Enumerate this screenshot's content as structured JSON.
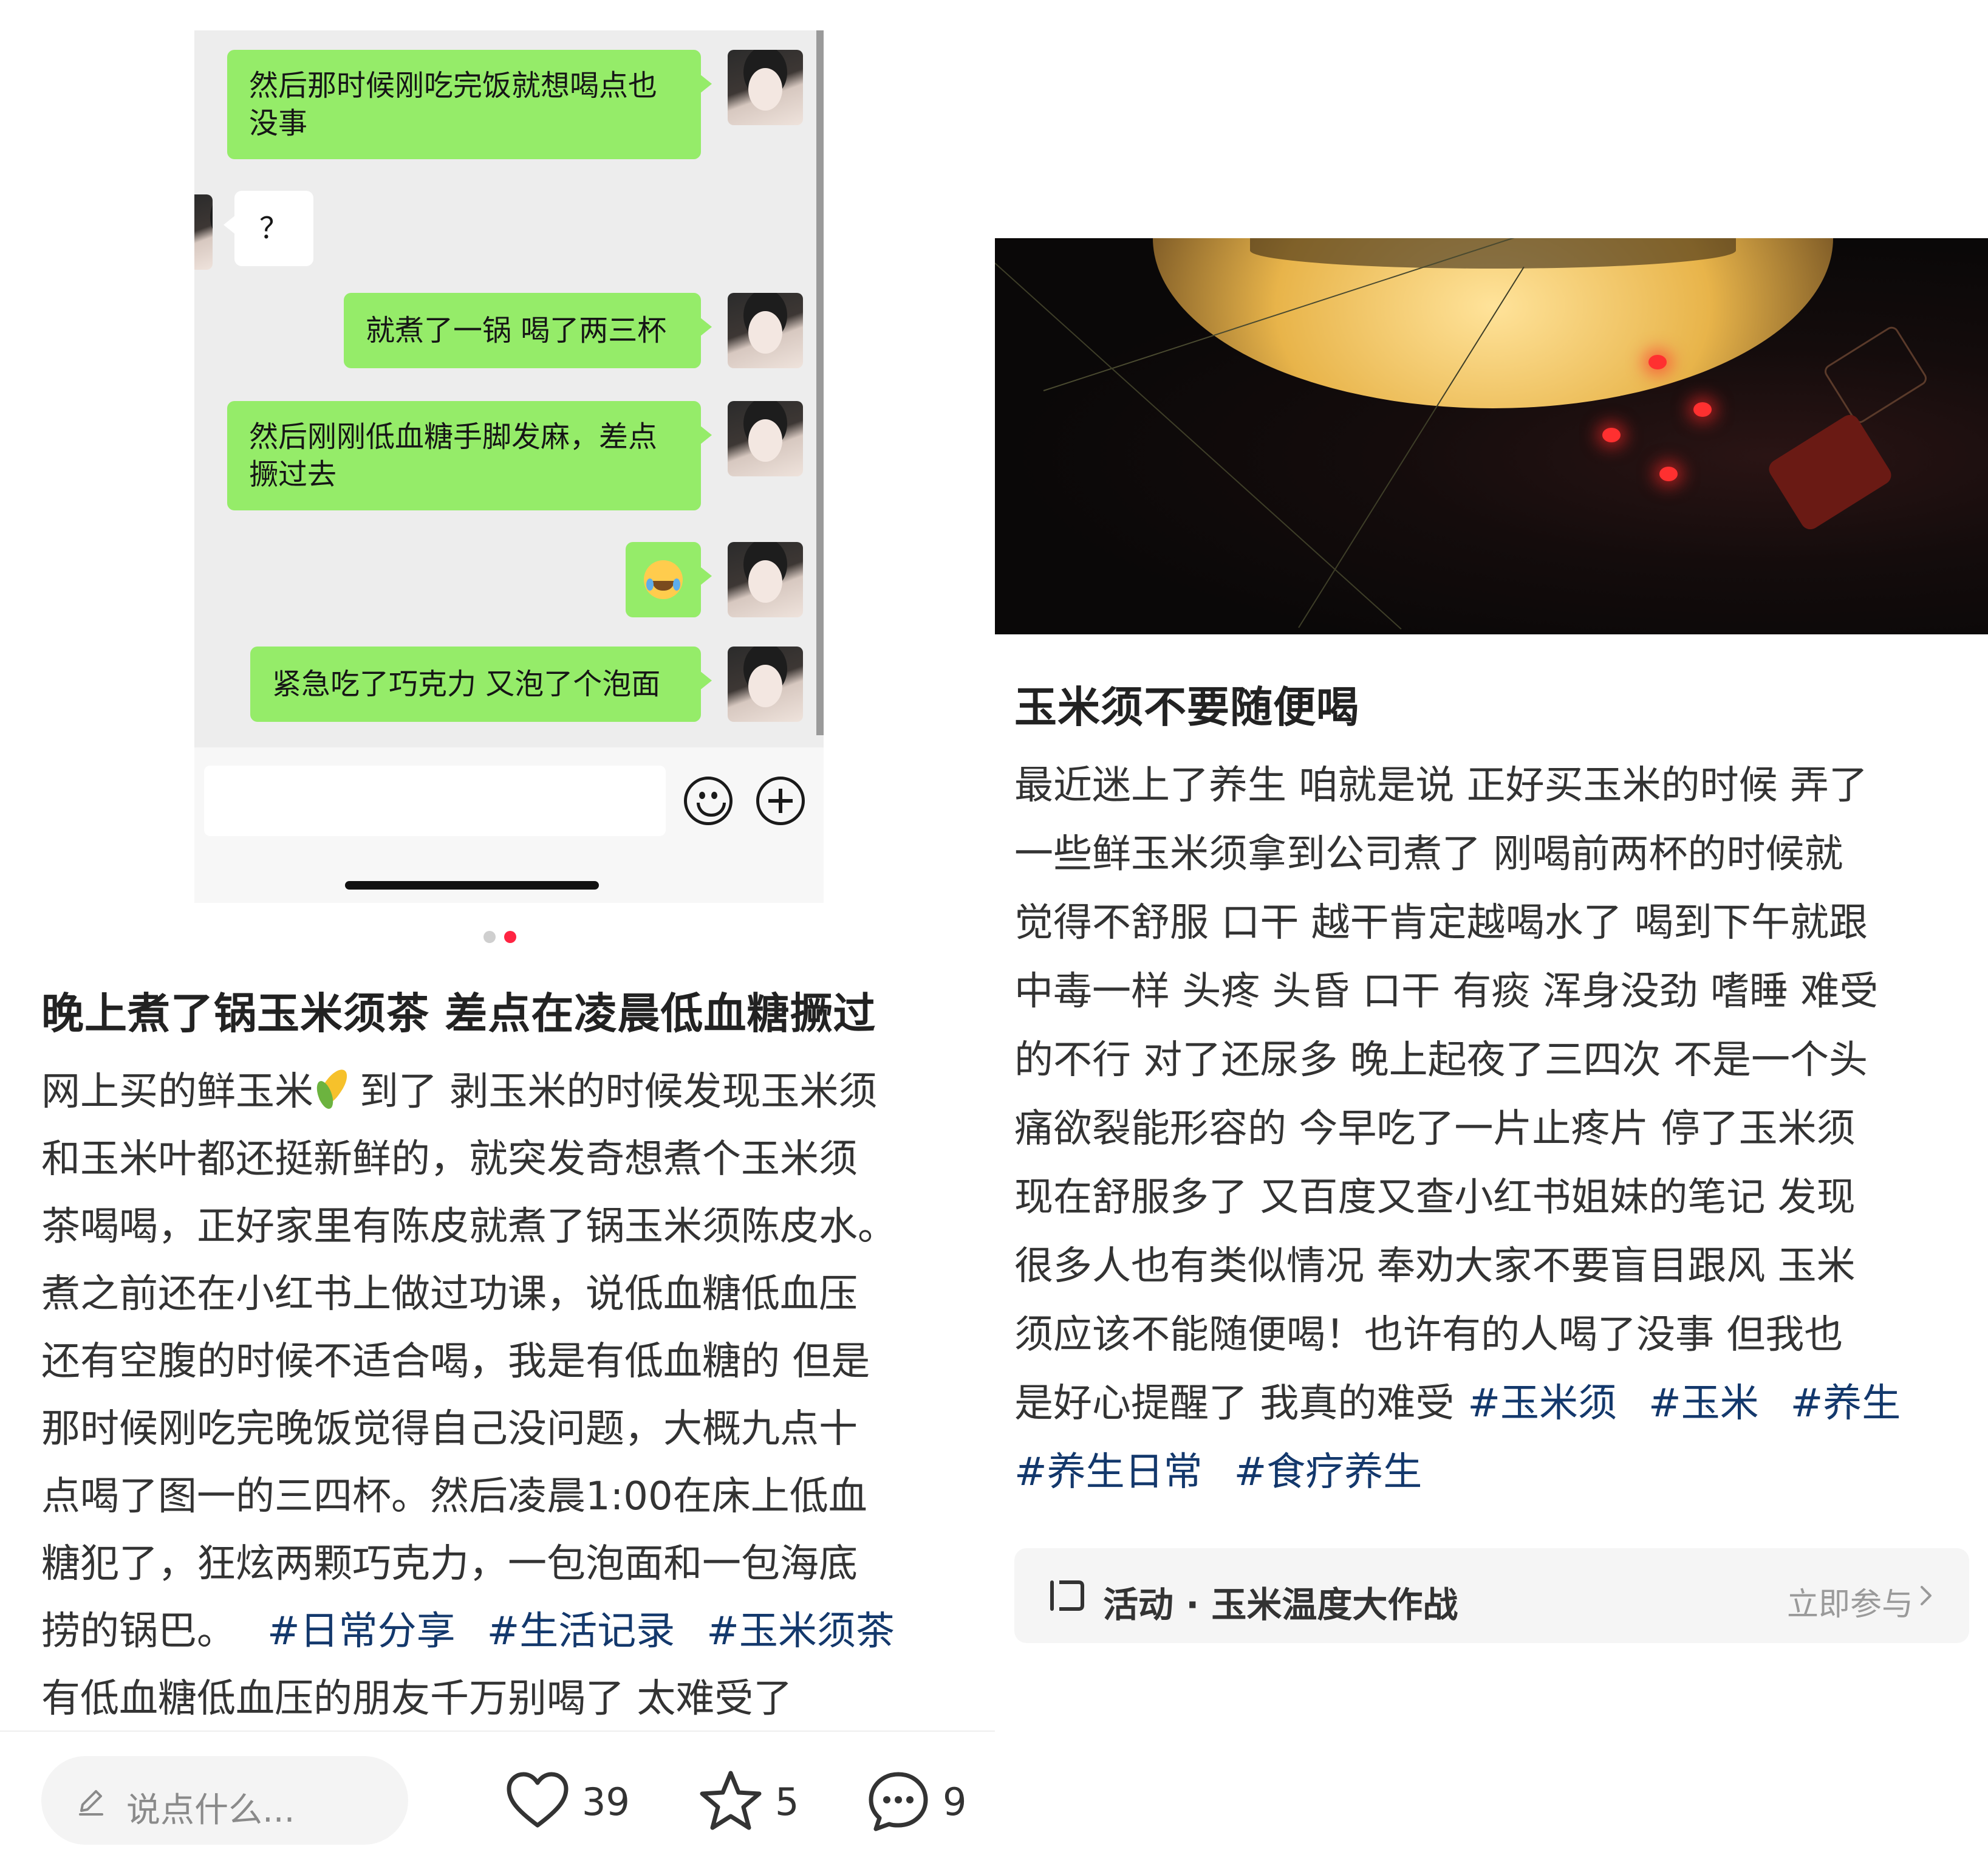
{
  "left_post": {
    "chat_messages": [
      {
        "side": "me",
        "text": "然后那时候刚吃完饭就想喝点也\n没事"
      },
      {
        "side": "other",
        "text": "？"
      },
      {
        "side": "me",
        "text": "就煮了一锅 喝了两三杯"
      },
      {
        "side": "me",
        "text": "然后刚刚低血糖手脚发麻，差点\n撅过去"
      },
      {
        "side": "me",
        "text": "",
        "emoji": "laughing-tears-emoji"
      },
      {
        "side": "me",
        "text": "紧急吃了巧克力 又泡了个泡面"
      }
    ],
    "carousel": {
      "count": 2,
      "active": 2
    },
    "title": "晚上煮了锅玉米须茶 差点在凌晨低血糖撅过",
    "body_lines": [
      {
        "before": "网上买的鲜玉米",
        "after": "到了 剥玉米的时候发现玉米须"
      },
      "和玉米叶都还挺新鲜的，就突发奇想煮个玉米须",
      "茶喝喝，正好家里有陈皮就煮了锅玉米须陈皮水。",
      "煮之前还在小红书上做过功课，说低血糖低血压",
      "还有空腹的时候不适合喝，我是有低血糖的 但是",
      "那时候刚吃完晚饭觉得自己没问题，大概九点十",
      "点喝了图一的三四杯。然后凌晨1:00在床上低血",
      "糖犯了，狂炫两颗巧克力，一包泡面和一包海底",
      "捞的锅巴。",
      "有低血糖低血压的朋友千万别喝了 太难受了"
    ],
    "tags": [
      "#日常分享",
      "#生活记录",
      "#玉米须茶"
    ],
    "bottom_bar": {
      "comment_placeholder": "说点什么...",
      "likes": "39",
      "collects": "5",
      "comments": "9"
    }
  },
  "right_post": {
    "title": "玉米须不要随便喝",
    "body_lines": [
      "最近迷上了养生 咱就是说 正好买玉米的时候 弄了",
      "一些鲜玉米须拿到公司煮了 刚喝前两杯的时候就",
      "觉得不舒服 口干 越干肯定越喝水了 喝到下午就跟",
      "中毒一样 头疼 头昏 口干 有痰 浑身没劲 嗜睡 难受",
      "的不行 对了还尿多 晚上起夜了三四次 不是一个头",
      "痛欲裂能形容的 今早吃了一片止疼片 停了玉米须",
      "现在舒服多了 又百度又查小红书姐妹的笔记 发现",
      "很多人也有类似情况 奉劝大家不要盲目跟风 玉米",
      "须应该不能随便喝！也许有的人喝了没事 但我也",
      "是好心提醒了 我真的难受"
    ],
    "tags_line1": [
      "#玉米须",
      "#玉米",
      "#养生"
    ],
    "tags_line2": [
      "#养生日常",
      "#食疗养生"
    ],
    "activity": {
      "label": "活动 · 玉米温度大作战",
      "join": "立即参与"
    }
  },
  "colors": {
    "tag": "#13386c",
    "bubble_me": "#95ec69",
    "dot_active": "#ff2442"
  },
  "icons": [
    "pencil-icon",
    "heart-icon",
    "star-icon",
    "chat-bubble-icon",
    "activity-icon",
    "chevron-right-icon",
    "emoji-icon",
    "plus-icon"
  ]
}
